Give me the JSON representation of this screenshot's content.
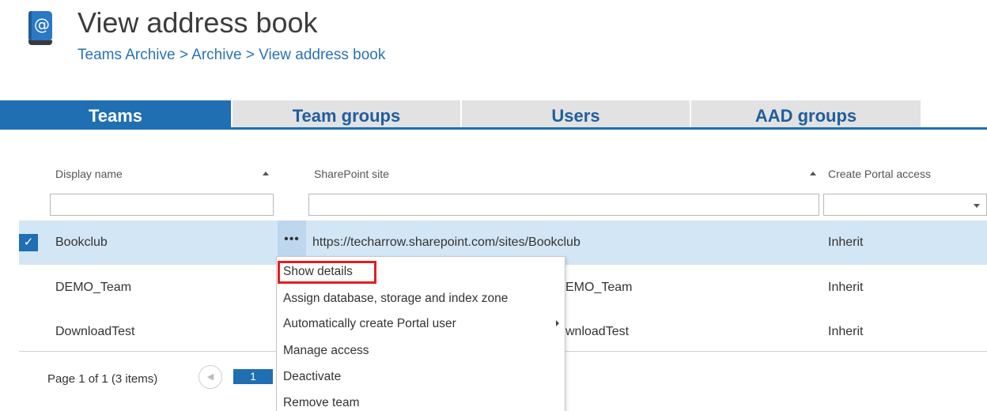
{
  "header": {
    "icon": "address-book-icon",
    "icon_glyph": "@",
    "title": "View address book",
    "breadcrumb": "Teams Archive > Archive > View address book"
  },
  "tabs": [
    {
      "label": "Teams",
      "active": true
    },
    {
      "label": "Team groups",
      "active": false
    },
    {
      "label": "Users",
      "active": false
    },
    {
      "label": "AAD groups",
      "active": false
    }
  ],
  "grid": {
    "columns": {
      "display_name": "Display name",
      "sharepoint_site": "SharePoint site",
      "create_portal_access": "Create Portal access"
    },
    "rows": [
      {
        "display_name": "Bookclub",
        "site": "https://techarrow.sharepoint.com/sites/Bookclub",
        "portal_access": "Inherit",
        "selected": true
      },
      {
        "display_name": "DEMO_Team",
        "site_visible": "EMO_Team",
        "portal_access": "Inherit",
        "selected": false
      },
      {
        "display_name": "DownloadTest",
        "site_visible": "wnloadTest",
        "portal_access": "Inherit",
        "selected": false
      }
    ],
    "row_menu_button": "•••",
    "check_glyph": "✓"
  },
  "pager": {
    "summary": "Page 1 of 1 (3 items)",
    "current_page": "1",
    "prev_glyph": "◀"
  },
  "context_menu": {
    "items": [
      "Show details",
      "Assign database, storage and index zone",
      "Automatically create Portal user",
      "Manage access",
      "Deactivate",
      "Remove team"
    ],
    "highlighted_item": "Show details",
    "highlight_color": "#e31e24"
  },
  "colors": {
    "accent": "#1f6fb2",
    "selected_row": "#d3e6f5",
    "link": "#2a72b4"
  }
}
